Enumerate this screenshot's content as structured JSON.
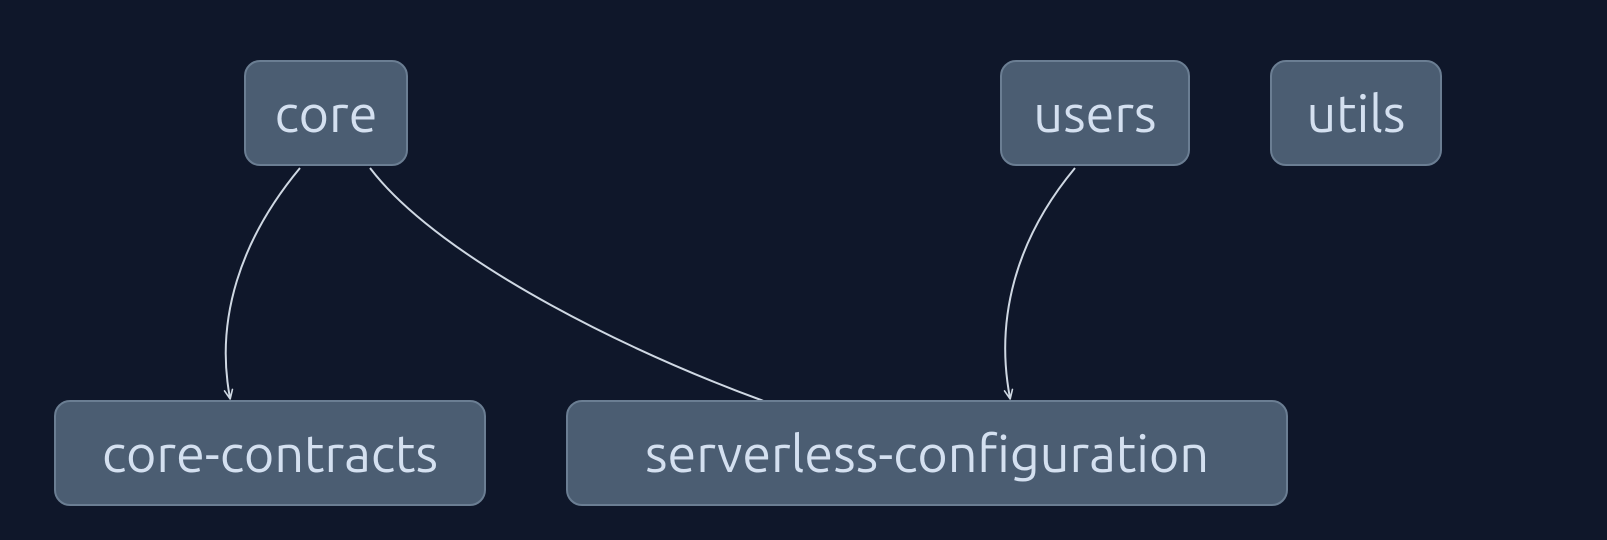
{
  "nodes": {
    "core": {
      "label": "core"
    },
    "users": {
      "label": "users"
    },
    "utils": {
      "label": "utils"
    },
    "core_contracts": {
      "label": "core-contracts"
    },
    "serverless_configuration": {
      "label": "serverless-configuration"
    }
  },
  "edges": [
    {
      "from": "core",
      "to": "core_contracts"
    },
    {
      "from": "core",
      "to": "serverless_configuration"
    },
    {
      "from": "users",
      "to": "serverless_configuration"
    }
  ],
  "colors": {
    "background": "#0f172a",
    "node_fill": "#4b5d72",
    "node_border": "#6b7e93",
    "node_text": "#d4e0f0",
    "edge_stroke": "#cfd8e3"
  }
}
